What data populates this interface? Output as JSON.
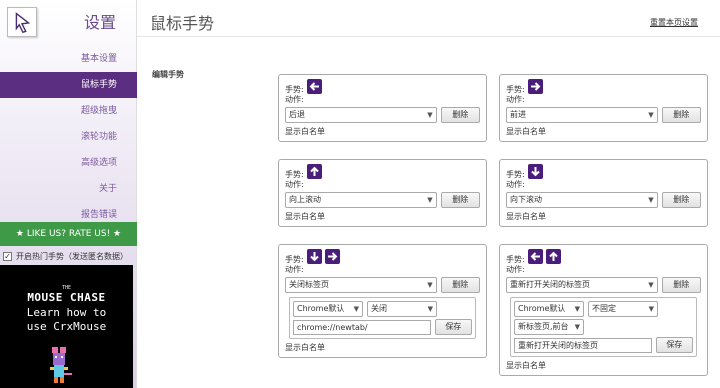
{
  "sidebar": {
    "title": "设置",
    "nav": [
      "基本设置",
      "鼠标手势",
      "超级拖曳",
      "滚轮功能",
      "高级选项",
      "关于",
      "报告错误"
    ],
    "active_index": 1,
    "like_us": "★ LIKE US? RATE US! ★",
    "hot_gesture_label": "开启热门手势（发送匿名数据）",
    "hot_gesture_checked": "✓",
    "ad": {
      "the": "THE",
      "title": "MOUSE CHASE",
      "line1": "Learn how to",
      "line2": "use CrxMouse"
    }
  },
  "header": {
    "title": "鼠标手势",
    "reset_link": "重置本页设置"
  },
  "section_label": "编辑手势",
  "labels": {
    "gesture": "手势:",
    "action": "动作:",
    "delete": "删除",
    "whitelist": "显示白名单",
    "save": "保存"
  },
  "cards": [
    {
      "arrows": [
        "left"
      ],
      "action": "后退"
    },
    {
      "arrows": [
        "right"
      ],
      "action": "前进"
    },
    {
      "arrows": [
        "up"
      ],
      "action": "向上滚动"
    },
    {
      "arrows": [
        "down"
      ],
      "action": "向下滚动"
    },
    {
      "arrows": [
        "down",
        "right"
      ],
      "action": "关闭标签页",
      "options": {
        "sel1": "Chrome默认",
        "sel2": "关闭",
        "url": "chrome://newtab/"
      }
    },
    {
      "arrows": [
        "left",
        "up"
      ],
      "action": "重新打开关闭的标签页",
      "options": {
        "sel1": "Chrome默认",
        "sel2": "不固定",
        "sel3": "新标签页,前台",
        "text": "重新打开关闭的标签页"
      }
    }
  ],
  "colors": {
    "accent": "#5b2e82",
    "like_us_bg": "#3f9a48",
    "arrow_bg": "#4a1d7a"
  },
  "icons": {
    "arrow": "arrow-icon",
    "logo": "cursor-logo-icon",
    "mouse": "pixel-mouse-icon"
  }
}
